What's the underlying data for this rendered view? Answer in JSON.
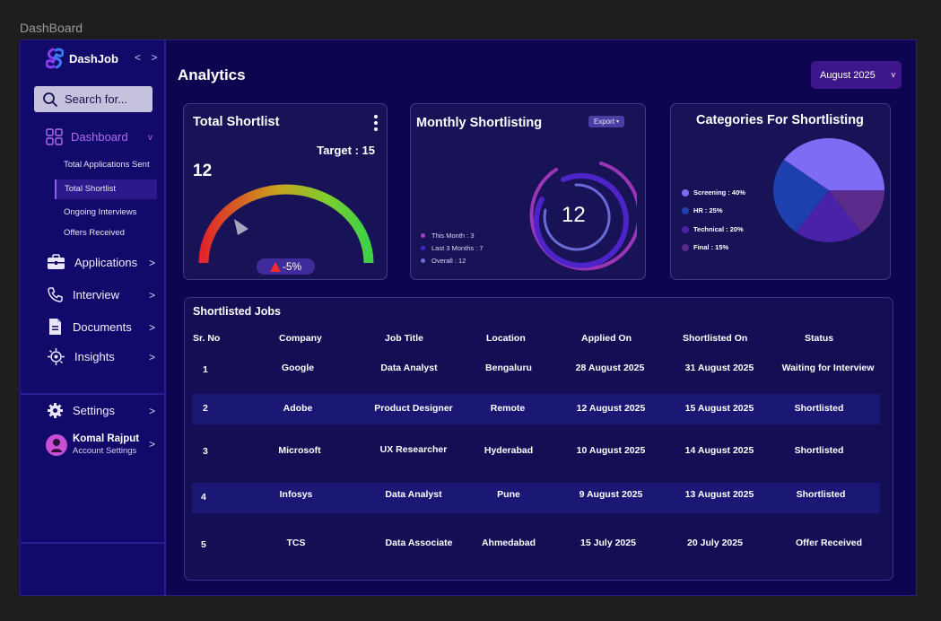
{
  "canvas_label": "DashBoard",
  "sidebar": {
    "brand": "DashJob",
    "collapse": "< >",
    "search_placeholder": "Search for...",
    "dashboard_label": "Dashboard",
    "dashboard_chevron": "v",
    "sub_items": [
      "Total Applications Sent",
      "Total Shortlist",
      "Ongoing Interviews",
      "Offers Received"
    ],
    "items": [
      {
        "label": "Applications",
        "icon": "briefcase-icon"
      },
      {
        "label": "Interview",
        "icon": "phone-icon"
      },
      {
        "label": "Documents",
        "icon": "document-icon"
      },
      {
        "label": "Insights",
        "icon": "insights-icon"
      }
    ],
    "chevron": ">",
    "settings_label": "Settings",
    "profile_name": "Komal Rajput",
    "profile_sub": "Account Settings"
  },
  "header": {
    "title": "Analytics",
    "month": "August 2025",
    "month_caret": "v"
  },
  "total_shortlist": {
    "title": "Total Shortlist",
    "target": "Target : 15",
    "value": "12",
    "delta": "-5%",
    "gauge_fraction": 0.15
  },
  "monthly": {
    "title": "Monthly Shortlisting",
    "export": "Export",
    "center": "12",
    "legend": [
      {
        "label": "This Month : 3",
        "color": "#a23fc0"
      },
      {
        "label": "Last 3 Months : 7",
        "color": "#4d24c9"
      },
      {
        "label": "Overall : 12",
        "color": "#6a6ad8"
      }
    ]
  },
  "categories": {
    "title": "Categories For Shortlisting",
    "legend": [
      {
        "label": "Screening : 40%",
        "color": "#7f6cf5"
      },
      {
        "label": "HR : 25%",
        "color": "#1e3fae"
      },
      {
        "label": "Technical : 20%",
        "color": "#4a22a8"
      },
      {
        "label": "Final : 15%",
        "color": "#5b2b8c"
      }
    ]
  },
  "chart_data": {
    "type": "pie",
    "title": "Categories For Shortlisting",
    "categories": [
      "Screening",
      "HR",
      "Technical",
      "Final"
    ],
    "values": [
      40,
      25,
      20,
      15
    ],
    "colors": [
      "#7f6cf5",
      "#1e3fae",
      "#4a22a8",
      "#5b2b8c"
    ]
  },
  "jobs": {
    "title": "Shortlisted Jobs",
    "headers": [
      "Sr. No",
      "Company",
      "Job Title",
      "Location",
      "Applied On",
      "Shortlisted On",
      "Status"
    ],
    "rows": [
      [
        "1",
        "Google",
        "Data Analyst",
        "Bengaluru",
        "28 August 2025",
        "31 August 2025",
        "Waiting for Interview"
      ],
      [
        "2",
        "Adobe",
        "Product Designer",
        "Remote",
        "12 August 2025",
        "15 August 2025",
        "Shortlisted"
      ],
      [
        "3",
        "Microsoft",
        "UX Researcher",
        "Hyderabad",
        "10 August 2025",
        "14 August 2025",
        "Shortlisted"
      ],
      [
        "4",
        "Infosys",
        "Data Analyst",
        "Pune",
        "9 August 2025",
        "13 August 2025",
        "Shortlisted"
      ],
      [
        "5",
        "TCS",
        "Data Associate",
        "Ahmedabad",
        "15 July 2025",
        "20 July 2025",
        "Offer Received"
      ]
    ]
  }
}
